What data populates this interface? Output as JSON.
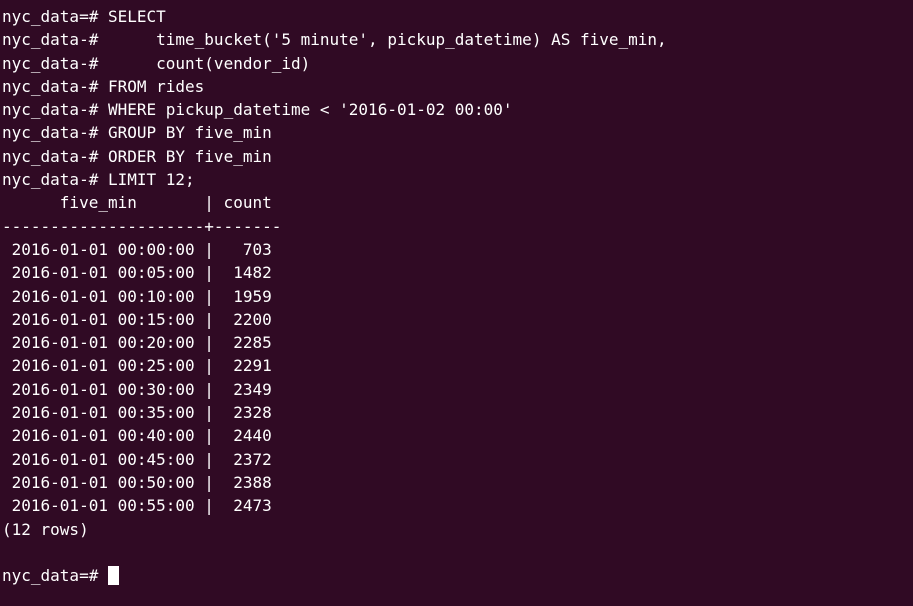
{
  "prompt": "nyc_data=# ",
  "continuation_prompt": "nyc_data-# ",
  "query_lines": [
    "SELECT",
    "     time_bucket('5 minute', pickup_datetime) AS five_min,",
    "     count(vendor_id)",
    "FROM rides",
    "WHERE pickup_datetime < '2016-01-02 00:00'",
    "GROUP BY five_min",
    "ORDER BY five_min",
    "LIMIT 12;"
  ],
  "result": {
    "header": "      five_min       | count ",
    "separator": "---------------------+-------",
    "rows": [
      " 2016-01-01 00:00:00 |   703",
      " 2016-01-01 00:05:00 |  1482",
      " 2016-01-01 00:10:00 |  1959",
      " 2016-01-01 00:15:00 |  2200",
      " 2016-01-01 00:20:00 |  2285",
      " 2016-01-01 00:25:00 |  2291",
      " 2016-01-01 00:30:00 |  2349",
      " 2016-01-01 00:35:00 |  2328",
      " 2016-01-01 00:40:00 |  2440",
      " 2016-01-01 00:45:00 |  2372",
      " 2016-01-01 00:50:00 |  2388",
      " 2016-01-01 00:55:00 |  2473"
    ],
    "footer": "(12 rows)"
  },
  "colors": {
    "background": "#300a24",
    "foreground": "#ffffff"
  }
}
